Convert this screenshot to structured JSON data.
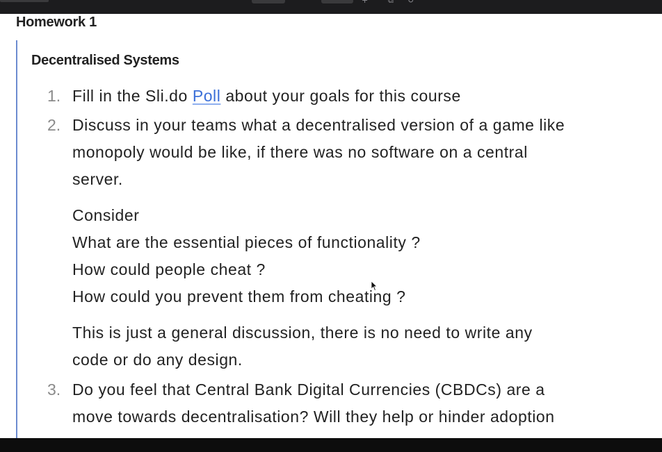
{
  "page_title": "Homework 1",
  "section_heading": "Decentralised Systems",
  "items": [
    {
      "number": "1.",
      "prefix": "Fill in the Sli.do ",
      "link_text": "Poll",
      "suffix": " about your goals for this course"
    },
    {
      "number": "2.",
      "lines": [
        "Discuss in your teams what a decentralised version of a game like",
        "monopoly would be like, if there was no software on a central",
        "server."
      ],
      "consider_heading": "Consider",
      "questions": [
        "What are the essential pieces of functionality ?",
        "How could people cheat ?",
        "How could you prevent them from cheating ?"
      ],
      "note_lines": [
        "This is just a general discussion, there is no need to write any",
        "code or do any design."
      ]
    },
    {
      "number": "3.",
      "lines": [
        "Do you feel that Central Bank Digital Currencies (CBDCs) are a",
        "move towards decentralisation? Will they help or hinder adoption"
      ]
    }
  ],
  "colors": {
    "link": "#3b6fd8",
    "quote_bar": "#6c8bd0",
    "text": "#222222",
    "list_number": "#8a8a8a"
  }
}
